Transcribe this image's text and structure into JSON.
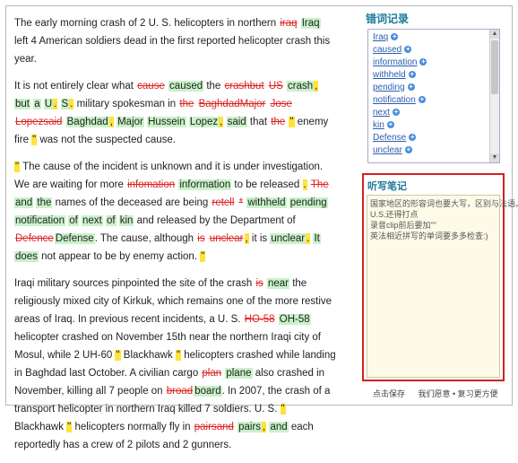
{
  "paragraphs": [
    [
      {
        "t": "The early morning crash of 2 U. S. helicopters in northern ",
        "c": ""
      },
      {
        "t": "iraq",
        "c": "del"
      },
      {
        "t": " ",
        "c": ""
      },
      {
        "t": "Iraq",
        "c": "ok"
      },
      {
        "t": " left 4 American soldiers dead in the first reported helicopter crash this year.",
        "c": ""
      }
    ],
    [
      {
        "t": "It is not entirely clear what ",
        "c": ""
      },
      {
        "t": "cause",
        "c": "del"
      },
      {
        "t": " ",
        "c": ""
      },
      {
        "t": "caused",
        "c": "ok"
      },
      {
        "t": " the ",
        "c": ""
      },
      {
        "t": "crashbut",
        "c": "del"
      },
      {
        "t": " ",
        "c": ""
      },
      {
        "t": "US",
        "c": "del"
      },
      {
        "t": " ",
        "c": ""
      },
      {
        "t": "crash",
        "c": "ok"
      },
      {
        "t": ",",
        "c": "hl"
      },
      {
        "t": " ",
        "c": ""
      },
      {
        "t": "but",
        "c": "ok"
      },
      {
        "t": " ",
        "c": ""
      },
      {
        "t": "a",
        "c": "ok"
      },
      {
        "t": " ",
        "c": ""
      },
      {
        "t": "U",
        "c": "ok"
      },
      {
        "t": ".",
        "c": "hl"
      },
      {
        "t": " ",
        "c": ""
      },
      {
        "t": "S",
        "c": "ok"
      },
      {
        "t": ".",
        "c": "hl"
      },
      {
        "t": " military spokesman in ",
        "c": ""
      },
      {
        "t": "the",
        "c": "del"
      },
      {
        "t": " ",
        "c": ""
      },
      {
        "t": "BaghdadMajor",
        "c": "del"
      },
      {
        "t": " ",
        "c": ""
      },
      {
        "t": "Jose",
        "c": "del"
      },
      {
        "t": " ",
        "c": ""
      },
      {
        "t": "Lopezsaid",
        "c": "del"
      },
      {
        "t": " ",
        "c": ""
      },
      {
        "t": "Baghdad",
        "c": "ok"
      },
      {
        "t": ",",
        "c": "hl"
      },
      {
        "t": " ",
        "c": ""
      },
      {
        "t": "Major",
        "c": "ok"
      },
      {
        "t": " ",
        "c": ""
      },
      {
        "t": "Hussein",
        "c": "ok"
      },
      {
        "t": " ",
        "c": ""
      },
      {
        "t": "Lopez",
        "c": "ok"
      },
      {
        "t": ",",
        "c": "hl"
      },
      {
        "t": " ",
        "c": ""
      },
      {
        "t": "said",
        "c": "ok"
      },
      {
        "t": " that ",
        "c": ""
      },
      {
        "t": "the",
        "c": "del"
      },
      {
        "t": " ",
        "c": ""
      },
      {
        "t": "\"",
        "c": "hl"
      },
      {
        "t": " enemy fire ",
        "c": ""
      },
      {
        "t": "\"",
        "c": "hl"
      },
      {
        "t": " was not the suspected cause.",
        "c": ""
      }
    ],
    [
      {
        "t": "\"",
        "c": "hl"
      },
      {
        "t": " The cause of the incident is unknown and it is under investigation. We are waiting for more ",
        "c": ""
      },
      {
        "t": "infomation",
        "c": "del"
      },
      {
        "t": " ",
        "c": ""
      },
      {
        "t": "information",
        "c": "ok"
      },
      {
        "t": " to be released ",
        "c": ""
      },
      {
        "t": ".",
        "c": "hl"
      },
      {
        "t": " ",
        "c": ""
      },
      {
        "t": "The",
        "c": "del"
      },
      {
        "t": " ",
        "c": ""
      },
      {
        "t": "and",
        "c": "ok"
      },
      {
        "t": " ",
        "c": ""
      },
      {
        "t": "the",
        "c": "ok"
      },
      {
        "t": " names of the deceased are being ",
        "c": ""
      },
      {
        "t": "retell",
        "c": "del"
      },
      {
        "t": " ",
        "c": ""
      },
      {
        "t": "*",
        "c": "del"
      },
      {
        "t": " ",
        "c": ""
      },
      {
        "t": "withheld",
        "c": "ok"
      },
      {
        "t": " ",
        "c": ""
      },
      {
        "t": "pending",
        "c": "ok"
      },
      {
        "t": " ",
        "c": ""
      },
      {
        "t": "notification",
        "c": "ok"
      },
      {
        "t": " ",
        "c": ""
      },
      {
        "t": "of",
        "c": "ok"
      },
      {
        "t": " ",
        "c": ""
      },
      {
        "t": "next",
        "c": "ok"
      },
      {
        "t": " ",
        "c": ""
      },
      {
        "t": "of",
        "c": "ok"
      },
      {
        "t": " ",
        "c": ""
      },
      {
        "t": "kin",
        "c": "ok"
      },
      {
        "t": " and released by the Department of ",
        "c": ""
      },
      {
        "t": "Defence",
        "c": "del"
      },
      {
        "t": "Defense",
        "c": "ok"
      },
      {
        "t": ". The cause, although ",
        "c": ""
      },
      {
        "t": "is",
        "c": "del"
      },
      {
        "t": " ",
        "c": ""
      },
      {
        "t": "unclear",
        "c": "del"
      },
      {
        "t": ",",
        "c": "hl"
      },
      {
        "t": " it is ",
        "c": ""
      },
      {
        "t": "unclear",
        "c": "ok"
      },
      {
        "t": ".",
        "c": "hl"
      },
      {
        "t": " ",
        "c": ""
      },
      {
        "t": "It",
        "c": "ok"
      },
      {
        "t": " ",
        "c": ""
      },
      {
        "t": "does",
        "c": "ok"
      },
      {
        "t": " not appear to be by enemy action. ",
        "c": ""
      },
      {
        "t": "\"",
        "c": "hl"
      }
    ],
    [
      {
        "t": "Iraqi military sources pinpointed the site of the crash ",
        "c": ""
      },
      {
        "t": "is",
        "c": "del"
      },
      {
        "t": " ",
        "c": ""
      },
      {
        "t": "near",
        "c": "ok"
      },
      {
        "t": " the religiously mixed city of Kirkuk, which remains one of the more restive areas of Iraq. In previous recent incidents, a U. S. ",
        "c": ""
      },
      {
        "t": "HO-58",
        "c": "del"
      },
      {
        "t": " ",
        "c": ""
      },
      {
        "t": "OH-58",
        "c": "ok"
      },
      {
        "t": " helicopter crashed on November 15th near the northern Iraqi city of Mosul, while 2 UH-60 ",
        "c": ""
      },
      {
        "t": "\"",
        "c": "hl"
      },
      {
        "t": " Blackhawk ",
        "c": ""
      },
      {
        "t": "\"",
        "c": "hl"
      },
      {
        "t": " helicopters crashed while landing in Baghdad last October. A civilian cargo ",
        "c": ""
      },
      {
        "t": "plan",
        "c": "del"
      },
      {
        "t": " ",
        "c": ""
      },
      {
        "t": "plane",
        "c": "ok"
      },
      {
        "t": " also crashed in November, killing all 7 people on ",
        "c": ""
      },
      {
        "t": "broad",
        "c": "del"
      },
      {
        "t": "board",
        "c": "ok"
      },
      {
        "t": ". In 2007, the crash of a transport helicopter in northern Iraq killed 7 soldiers. U. S. ",
        "c": ""
      },
      {
        "t": "\"",
        "c": "hl"
      },
      {
        "t": " Blackhawk ",
        "c": ""
      },
      {
        "t": "\"",
        "c": "hl"
      },
      {
        "t": " helicopters normally fly in ",
        "c": ""
      },
      {
        "t": "pairsand",
        "c": "del"
      },
      {
        "t": " ",
        "c": ""
      },
      {
        "t": "pairs",
        "c": "ok"
      },
      {
        "t": ",",
        "c": "hl"
      },
      {
        "t": " ",
        "c": ""
      },
      {
        "t": "and",
        "c": "ok"
      },
      {
        "t": " each reportedly has a crew of 2 pilots and 2 gunners.",
        "c": ""
      }
    ]
  ],
  "words_section": {
    "title": "错词记录",
    "items": [
      "Iraq",
      "caused",
      "information",
      "withheld",
      "pending",
      "notification",
      "next",
      "kin",
      "Defense",
      "unclear"
    ]
  },
  "notes_section": {
    "title": "听写笔记",
    "lines": [
      "国家地区的形容词也要大写，区别与法语。",
      "U.S.还得打点",
      "录音clip前后要加\"\"",
      "英法相近拼写的单词要多多检查:)"
    ]
  },
  "bottom_links": {
    "save": "点击保存",
    "other": "我们愿意 • 复习更方便"
  },
  "colors": {
    "correct_bg": "#c9f2c9",
    "wrong": "#dd2222",
    "punct_bg": "#ffe23a",
    "notes_border": "#d42020"
  }
}
